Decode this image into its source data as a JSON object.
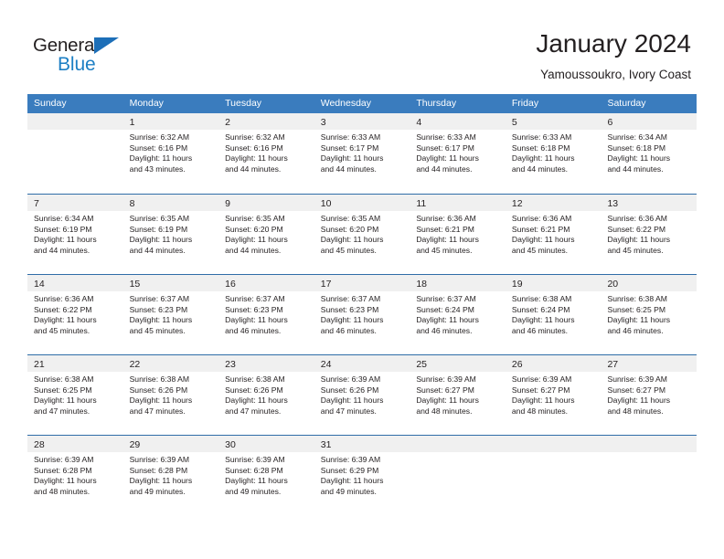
{
  "brand": {
    "name_part1": "General",
    "name_part2": "Blue",
    "accent_color": "#1d7fc4",
    "triangle_color": "#1d6fb8"
  },
  "header": {
    "title": "January 2024",
    "location": "Yamoussoukro, Ivory Coast"
  },
  "theme": {
    "header_bar": "#3a7cbe",
    "week_divider": "#2f6da8",
    "day_band": "#f0f0f0",
    "text": "#231f20"
  },
  "weekdays": [
    "Sunday",
    "Monday",
    "Tuesday",
    "Wednesday",
    "Thursday",
    "Friday",
    "Saturday"
  ],
  "weeks": [
    [
      {
        "day": "",
        "sunrise": "",
        "sunset": "",
        "daylight1": "",
        "daylight2": ""
      },
      {
        "day": "1",
        "sunrise": "Sunrise: 6:32 AM",
        "sunset": "Sunset: 6:16 PM",
        "daylight1": "Daylight: 11 hours",
        "daylight2": "and 43 minutes."
      },
      {
        "day": "2",
        "sunrise": "Sunrise: 6:32 AM",
        "sunset": "Sunset: 6:16 PM",
        "daylight1": "Daylight: 11 hours",
        "daylight2": "and 44 minutes."
      },
      {
        "day": "3",
        "sunrise": "Sunrise: 6:33 AM",
        "sunset": "Sunset: 6:17 PM",
        "daylight1": "Daylight: 11 hours",
        "daylight2": "and 44 minutes."
      },
      {
        "day": "4",
        "sunrise": "Sunrise: 6:33 AM",
        "sunset": "Sunset: 6:17 PM",
        "daylight1": "Daylight: 11 hours",
        "daylight2": "and 44 minutes."
      },
      {
        "day": "5",
        "sunrise": "Sunrise: 6:33 AM",
        "sunset": "Sunset: 6:18 PM",
        "daylight1": "Daylight: 11 hours",
        "daylight2": "and 44 minutes."
      },
      {
        "day": "6",
        "sunrise": "Sunrise: 6:34 AM",
        "sunset": "Sunset: 6:18 PM",
        "daylight1": "Daylight: 11 hours",
        "daylight2": "and 44 minutes."
      }
    ],
    [
      {
        "day": "7",
        "sunrise": "Sunrise: 6:34 AM",
        "sunset": "Sunset: 6:19 PM",
        "daylight1": "Daylight: 11 hours",
        "daylight2": "and 44 minutes."
      },
      {
        "day": "8",
        "sunrise": "Sunrise: 6:35 AM",
        "sunset": "Sunset: 6:19 PM",
        "daylight1": "Daylight: 11 hours",
        "daylight2": "and 44 minutes."
      },
      {
        "day": "9",
        "sunrise": "Sunrise: 6:35 AM",
        "sunset": "Sunset: 6:20 PM",
        "daylight1": "Daylight: 11 hours",
        "daylight2": "and 44 minutes."
      },
      {
        "day": "10",
        "sunrise": "Sunrise: 6:35 AM",
        "sunset": "Sunset: 6:20 PM",
        "daylight1": "Daylight: 11 hours",
        "daylight2": "and 45 minutes."
      },
      {
        "day": "11",
        "sunrise": "Sunrise: 6:36 AM",
        "sunset": "Sunset: 6:21 PM",
        "daylight1": "Daylight: 11 hours",
        "daylight2": "and 45 minutes."
      },
      {
        "day": "12",
        "sunrise": "Sunrise: 6:36 AM",
        "sunset": "Sunset: 6:21 PM",
        "daylight1": "Daylight: 11 hours",
        "daylight2": "and 45 minutes."
      },
      {
        "day": "13",
        "sunrise": "Sunrise: 6:36 AM",
        "sunset": "Sunset: 6:22 PM",
        "daylight1": "Daylight: 11 hours",
        "daylight2": "and 45 minutes."
      }
    ],
    [
      {
        "day": "14",
        "sunrise": "Sunrise: 6:36 AM",
        "sunset": "Sunset: 6:22 PM",
        "daylight1": "Daylight: 11 hours",
        "daylight2": "and 45 minutes."
      },
      {
        "day": "15",
        "sunrise": "Sunrise: 6:37 AM",
        "sunset": "Sunset: 6:23 PM",
        "daylight1": "Daylight: 11 hours",
        "daylight2": "and 45 minutes."
      },
      {
        "day": "16",
        "sunrise": "Sunrise: 6:37 AM",
        "sunset": "Sunset: 6:23 PM",
        "daylight1": "Daylight: 11 hours",
        "daylight2": "and 46 minutes."
      },
      {
        "day": "17",
        "sunrise": "Sunrise: 6:37 AM",
        "sunset": "Sunset: 6:23 PM",
        "daylight1": "Daylight: 11 hours",
        "daylight2": "and 46 minutes."
      },
      {
        "day": "18",
        "sunrise": "Sunrise: 6:37 AM",
        "sunset": "Sunset: 6:24 PM",
        "daylight1": "Daylight: 11 hours",
        "daylight2": "and 46 minutes."
      },
      {
        "day": "19",
        "sunrise": "Sunrise: 6:38 AM",
        "sunset": "Sunset: 6:24 PM",
        "daylight1": "Daylight: 11 hours",
        "daylight2": "and 46 minutes."
      },
      {
        "day": "20",
        "sunrise": "Sunrise: 6:38 AM",
        "sunset": "Sunset: 6:25 PM",
        "daylight1": "Daylight: 11 hours",
        "daylight2": "and 46 minutes."
      }
    ],
    [
      {
        "day": "21",
        "sunrise": "Sunrise: 6:38 AM",
        "sunset": "Sunset: 6:25 PM",
        "daylight1": "Daylight: 11 hours",
        "daylight2": "and 47 minutes."
      },
      {
        "day": "22",
        "sunrise": "Sunrise: 6:38 AM",
        "sunset": "Sunset: 6:26 PM",
        "daylight1": "Daylight: 11 hours",
        "daylight2": "and 47 minutes."
      },
      {
        "day": "23",
        "sunrise": "Sunrise: 6:38 AM",
        "sunset": "Sunset: 6:26 PM",
        "daylight1": "Daylight: 11 hours",
        "daylight2": "and 47 minutes."
      },
      {
        "day": "24",
        "sunrise": "Sunrise: 6:39 AM",
        "sunset": "Sunset: 6:26 PM",
        "daylight1": "Daylight: 11 hours",
        "daylight2": "and 47 minutes."
      },
      {
        "day": "25",
        "sunrise": "Sunrise: 6:39 AM",
        "sunset": "Sunset: 6:27 PM",
        "daylight1": "Daylight: 11 hours",
        "daylight2": "and 48 minutes."
      },
      {
        "day": "26",
        "sunrise": "Sunrise: 6:39 AM",
        "sunset": "Sunset: 6:27 PM",
        "daylight1": "Daylight: 11 hours",
        "daylight2": "and 48 minutes."
      },
      {
        "day": "27",
        "sunrise": "Sunrise: 6:39 AM",
        "sunset": "Sunset: 6:27 PM",
        "daylight1": "Daylight: 11 hours",
        "daylight2": "and 48 minutes."
      }
    ],
    [
      {
        "day": "28",
        "sunrise": "Sunrise: 6:39 AM",
        "sunset": "Sunset: 6:28 PM",
        "daylight1": "Daylight: 11 hours",
        "daylight2": "and 48 minutes."
      },
      {
        "day": "29",
        "sunrise": "Sunrise: 6:39 AM",
        "sunset": "Sunset: 6:28 PM",
        "daylight1": "Daylight: 11 hours",
        "daylight2": "and 49 minutes."
      },
      {
        "day": "30",
        "sunrise": "Sunrise: 6:39 AM",
        "sunset": "Sunset: 6:28 PM",
        "daylight1": "Daylight: 11 hours",
        "daylight2": "and 49 minutes."
      },
      {
        "day": "31",
        "sunrise": "Sunrise: 6:39 AM",
        "sunset": "Sunset: 6:29 PM",
        "daylight1": "Daylight: 11 hours",
        "daylight2": "and 49 minutes."
      },
      {
        "day": "",
        "sunrise": "",
        "sunset": "",
        "daylight1": "",
        "daylight2": ""
      },
      {
        "day": "",
        "sunrise": "",
        "sunset": "",
        "daylight1": "",
        "daylight2": ""
      },
      {
        "day": "",
        "sunrise": "",
        "sunset": "",
        "daylight1": "",
        "daylight2": ""
      }
    ]
  ]
}
